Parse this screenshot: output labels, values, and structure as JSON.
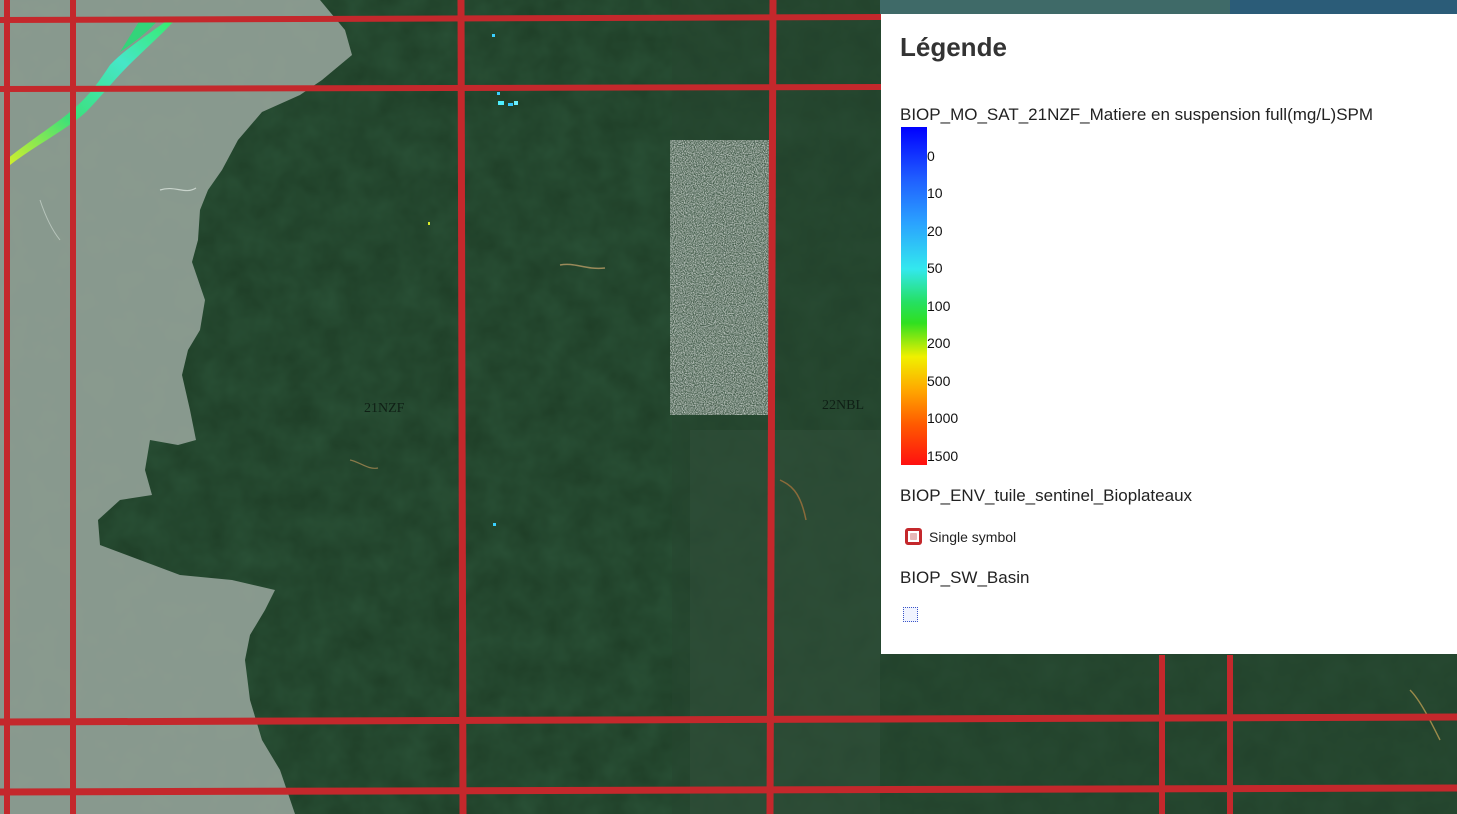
{
  "map": {
    "tile_labels": [
      {
        "id": "21nzf",
        "text": "21NZF"
      },
      {
        "id": "22nbl",
        "text": "22NBL"
      }
    ],
    "colors": {
      "tile_grid": "#c4282c",
      "forest": "#1e3d26",
      "basin_mask": "#8e9e93"
    }
  },
  "legend": {
    "title": "Légende",
    "layers": [
      {
        "name": "BIOP_MO_SAT_21NZF_Matiere en suspension full(mg/L)SPM",
        "ramp_labels": [
          "0",
          "10",
          "20",
          "50",
          "100",
          "200",
          "500",
          "1000",
          "1500"
        ]
      },
      {
        "name": "BIOP_ENV_tuile_sentinel_Bioplateaux",
        "symbol_label": "Single symbol",
        "symbol_icon": "square-outline-icon"
      },
      {
        "name": "BIOP_SW_Basin",
        "symbol_icon": "dotted-square-icon"
      }
    ]
  }
}
